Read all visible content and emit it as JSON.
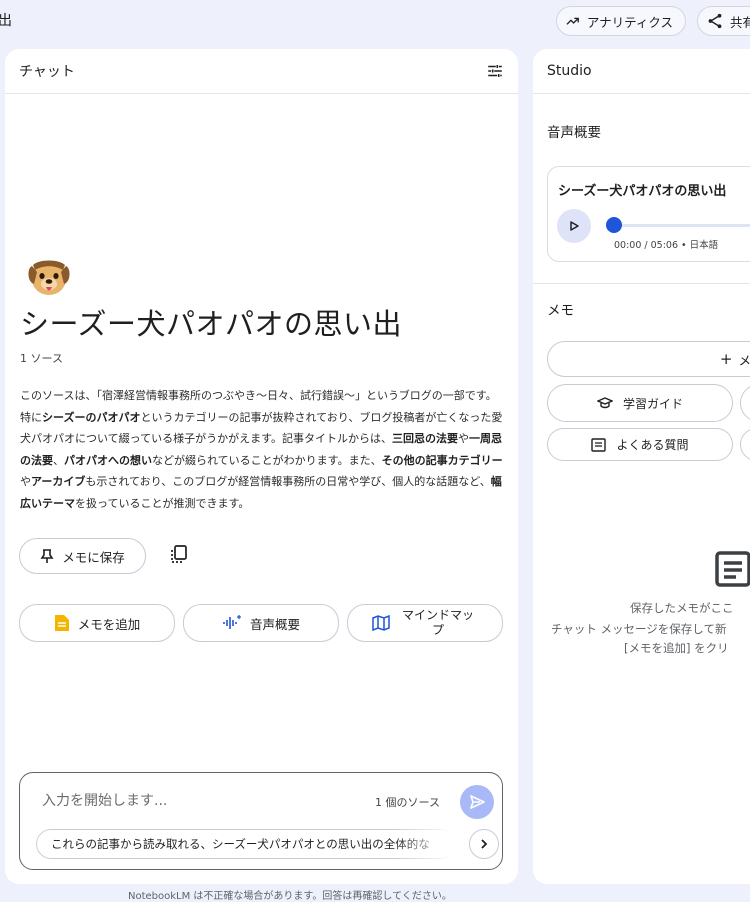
{
  "topbar": {
    "left_char": "出",
    "analytics_label": "アナリティクス",
    "share_label": "共有"
  },
  "chat": {
    "header_title": "チャット",
    "notebook_title": "シーズー犬パオパオの思い出",
    "source_count": "1 ソース",
    "summary": [
      {
        "text": "このソースは、「宿澤経営情報事務所のつぶやき〜日々、試行錯誤〜」というブログの一部です。特に",
        "bold": false
      },
      {
        "text": "シーズーのパオパオ",
        "bold": true
      },
      {
        "text": "というカテゴリーの記事が抜粋されており、ブログ投稿者が亡くなった愛犬パオパオについて綴っている様子がうかがえます。記事タイトルからは、",
        "bold": false
      },
      {
        "text": "三回忌の法要",
        "bold": true
      },
      {
        "text": "や",
        "bold": false
      },
      {
        "text": "一周忌の法要",
        "bold": true
      },
      {
        "text": "、",
        "bold": false
      },
      {
        "text": "パオパオへの想い",
        "bold": true
      },
      {
        "text": "などが綴られていることがわかります。また、",
        "bold": false
      },
      {
        "text": "その他の記事カテゴリー",
        "bold": true
      },
      {
        "text": "や",
        "bold": false
      },
      {
        "text": "アーカイブ",
        "bold": true
      },
      {
        "text": "も示されており、このブログが経営情報事務所の日常や学び、個人的な話題など、",
        "bold": false
      },
      {
        "text": "幅広いテーマ",
        "bold": true
      },
      {
        "text": "を扱っていることが推測できます。",
        "bold": false
      }
    ],
    "save_to_note_label": "メモに保存",
    "add_note_label": "メモを追加",
    "audio_overview_label": "音声概要",
    "mindmap_label": "マインドマップ",
    "input_placeholder": "入力を開始します...",
    "input_source_count": "1 個のソース",
    "suggestion": "これらの記事から読み取れる、シーズー犬パオパオとの思い出の全体的な",
    "disclaimer": "NotebookLM は不正確な場合があります。回答は再確認してください。"
  },
  "studio": {
    "header_title": "Studio",
    "audio_section_title": "音声概要",
    "audio_card_title": "シーズー犬パオパオの思い出",
    "audio_time": "00:00 / 05:06 • 日本語",
    "audio_progress": 0,
    "memo_section_title": "メモ",
    "add_memo_label": "メモを",
    "study_guide_label": "学習ガイド",
    "faq_label": "よくある質問",
    "empty_line1": "保存したメモがここ",
    "empty_line2": "チャット メッセージを保存して新",
    "empty_line3": "[メモを追加] をクリ"
  },
  "colors": {
    "background": "#eef0fb",
    "accent": "#1f55d8",
    "send_button": "#a9b8f7",
    "note_icon": "#f4b400"
  }
}
